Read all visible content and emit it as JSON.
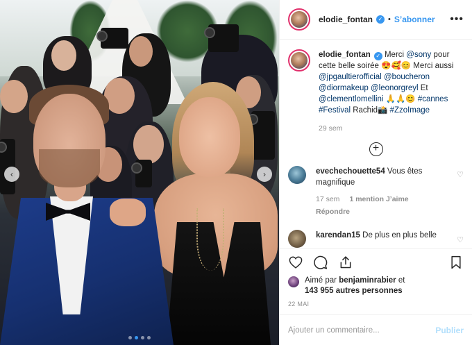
{
  "header": {
    "username": "elodie_fontan",
    "follow_label": "S’abonner",
    "more_icon": "•••"
  },
  "photo": {
    "prev_icon": "‹",
    "next_icon": "›",
    "carousel_total": 4,
    "carousel_active": 2
  },
  "caption": {
    "username": "elodie_fontan",
    "line1": "Merci ",
    "mention_sony": "@sony",
    "line2": " pour cette belle soirée 😍🥰😊 Merci aussi ",
    "mention_1": "@jpgaultierofficial",
    "mention_2": "@boucheron",
    "mention_3": "@diormakeup",
    "mention_4": "@leonorgreyl",
    "et": " Et ",
    "mention_5": "@clementlomellini",
    "emoji_mid": " 🙏🙏😊 ",
    "hashtag_1": "#cannes",
    "hashtag_2": "#Festival",
    "rachid": " Rachid📸 ",
    "hashtag_3": "#ZzoImage",
    "time": "29 sem"
  },
  "comments": [
    {
      "username": "evechechouette54",
      "text": "Vous êtes magnifique",
      "time": "17 sem",
      "likes": "1 mention J’aime",
      "reply_label": "Répondre"
    },
    {
      "username": "karendan15",
      "text": "De plus en plus belle"
    }
  ],
  "likes": {
    "prefix": "Aimé par ",
    "user": "benjaminrabier",
    "and": " et",
    "count": "143 955 autres personnes"
  },
  "date": "22 MAI",
  "add_comment": {
    "placeholder": "Ajouter un commentaire...",
    "publish_label": "Publier"
  },
  "colors": {
    "link": "#003569",
    "accent": "#3897f0",
    "muted": "#8e8e8e"
  }
}
